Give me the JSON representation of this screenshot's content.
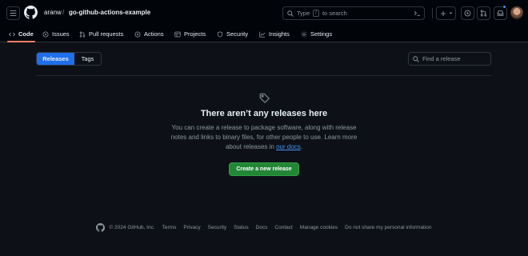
{
  "header": {
    "owner": "aranw",
    "separator": "/",
    "repo": "go-github-actions-example",
    "search": {
      "prefix": "Type",
      "key": "/",
      "suffix": "to search"
    },
    "command_palette": ">_"
  },
  "tabs": [
    {
      "label": "Code",
      "icon": "code-icon",
      "active": true
    },
    {
      "label": "Issues",
      "icon": "issue-icon"
    },
    {
      "label": "Pull requests",
      "icon": "pull-request-icon"
    },
    {
      "label": "Actions",
      "icon": "play-icon"
    },
    {
      "label": "Projects",
      "icon": "table-icon"
    },
    {
      "label": "Security",
      "icon": "shield-icon"
    },
    {
      "label": "Insights",
      "icon": "graph-icon"
    },
    {
      "label": "Settings",
      "icon": "gear-icon"
    }
  ],
  "releases_nav": {
    "releases_label": "Releases",
    "tags_label": "Tags",
    "find_placeholder": "Find a release"
  },
  "blankslate": {
    "title": "There aren’t any releases here",
    "desc_before": "You can create a release to package software, along with release notes and links to binary files, for other people to use. Learn more about releases in ",
    "desc_link": "our docs",
    "desc_after": ".",
    "cta_label": "Create a new release"
  },
  "footer": {
    "copyright": "© 2024 GitHub, Inc.",
    "links": [
      "Terms",
      "Privacy",
      "Security",
      "Status",
      "Docs",
      "Contact",
      "Manage cookies",
      "Do not share my personal information"
    ]
  },
  "colors": {
    "accent_blue": "#1f6feb",
    "primary_green": "#238636",
    "active_underline": "#f78166",
    "link_blue": "#4493f8"
  }
}
